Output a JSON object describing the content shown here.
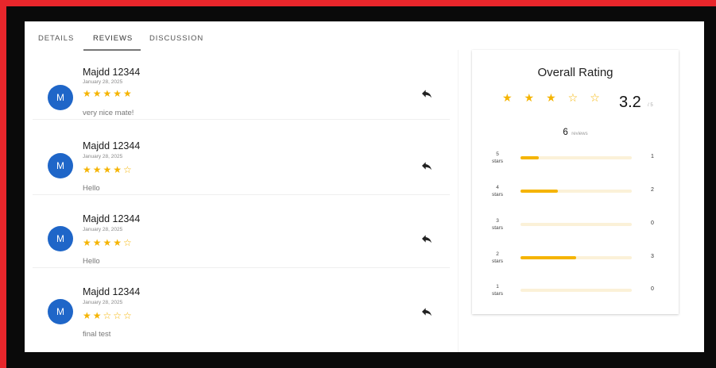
{
  "tabs": [
    {
      "label": "DETAILS",
      "active": false
    },
    {
      "label": "REVIEWS",
      "active": true
    },
    {
      "label": "DISCUSSION",
      "active": false
    }
  ],
  "reviews": [
    {
      "avatar": "M",
      "name": "Majdd 12344",
      "date": "January 28, 2025",
      "stars": "★★★★★",
      "rating": 5,
      "text": "very nice mate!"
    },
    {
      "avatar": "M",
      "name": "Majdd 12344",
      "date": "January 28, 2025",
      "stars": "★★★★☆",
      "rating": 4,
      "text": "Hello"
    },
    {
      "avatar": "M",
      "name": "Majdd 12344",
      "date": "January 28, 2025",
      "stars": "★★★★☆",
      "rating": 4,
      "text": "Hello"
    },
    {
      "avatar": "M",
      "name": "Majdd 12344",
      "date": "January 28, 2025",
      "stars": "★★☆☆☆",
      "rating": 2,
      "text": "final test"
    }
  ],
  "summary": {
    "title": "Overall Rating",
    "stars": "★★★☆☆",
    "score": "3.2",
    "max": "/ 5",
    "count": "6",
    "count_label": "reviews",
    "distribution": [
      {
        "line1": "5",
        "line2": "stars",
        "count": "1",
        "fraction": 0.167
      },
      {
        "line1": "4",
        "line2": "stars",
        "count": "2",
        "fraction": 0.333
      },
      {
        "line1": "3",
        "line2": "stars",
        "count": "0",
        "fraction": 0
      },
      {
        "line1": "2",
        "line2": "stars",
        "count": "3",
        "fraction": 0.5
      },
      {
        "line1": "1",
        "line2": "stars",
        "count": "0",
        "fraction": 0
      }
    ]
  },
  "colors": {
    "star": "#f5b400",
    "avatar": "#1f66c8",
    "frame": "#e8262b"
  },
  "icons": {
    "reply": "reply-icon"
  }
}
